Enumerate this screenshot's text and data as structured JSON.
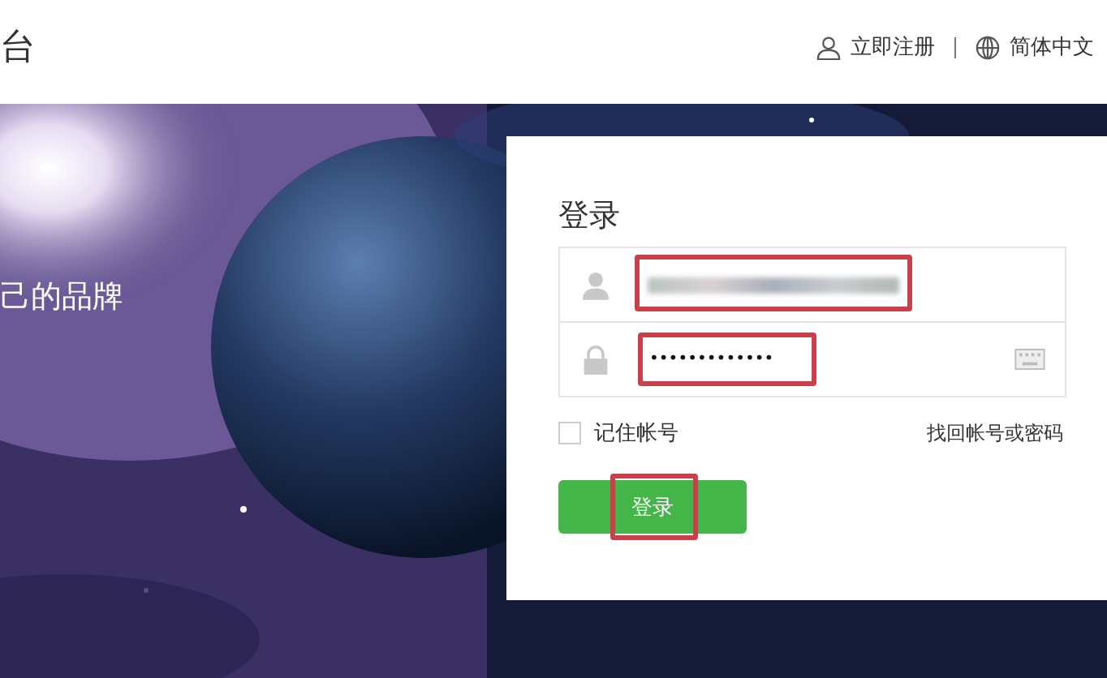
{
  "header": {
    "logo_fragment": "台",
    "links": [
      {
        "kind": "register",
        "label": "立即注册"
      },
      {
        "kind": "language",
        "label": "简体中文"
      }
    ]
  },
  "banner": {
    "slogan": "己的品牌"
  },
  "login": {
    "title": "登录",
    "username": {
      "blurred": true,
      "highlighted": true
    },
    "password": {
      "value": "•••••••••••••",
      "highlighted": true
    },
    "remember": {
      "label": "记住帐号",
      "checked": false
    },
    "forgot_link": "找回帐号或密码",
    "submit": {
      "label": "登录",
      "highlighted": true
    }
  }
}
